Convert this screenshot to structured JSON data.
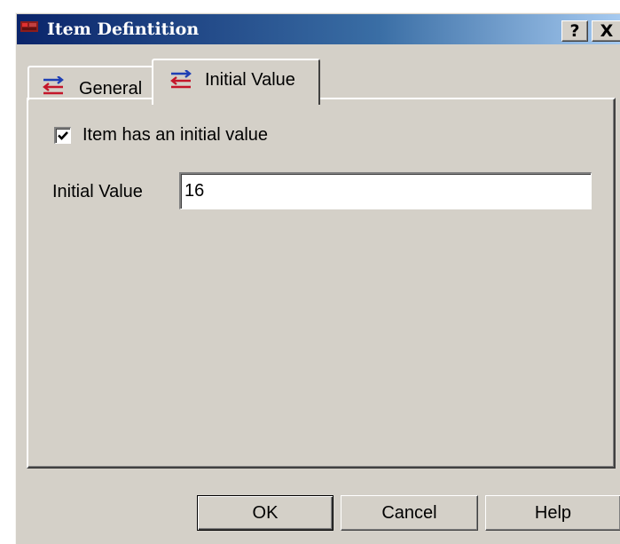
{
  "window": {
    "title": "Item Defintition",
    "help_button": "?",
    "close_button": "X"
  },
  "tabs": [
    {
      "label": "General",
      "icon": "transfer-arrows-icon",
      "selected": false
    },
    {
      "label": "Initial Value",
      "icon": "transfer-arrows-icon",
      "selected": true
    }
  ],
  "initial_value_tab": {
    "has_initial_value_label": "Item has an initial value",
    "has_initial_value_checked": true,
    "initial_value_label": "Initial Value",
    "initial_value": "16"
  },
  "buttons": {
    "ok": "OK",
    "cancel": "Cancel",
    "help": "Help"
  },
  "colors": {
    "titlebar_start": "#0a246a",
    "titlebar_end": "#a6caf0",
    "face": "#d4d0c8",
    "icon_red": "#c4162a",
    "icon_blue": "#1f3fb4"
  }
}
